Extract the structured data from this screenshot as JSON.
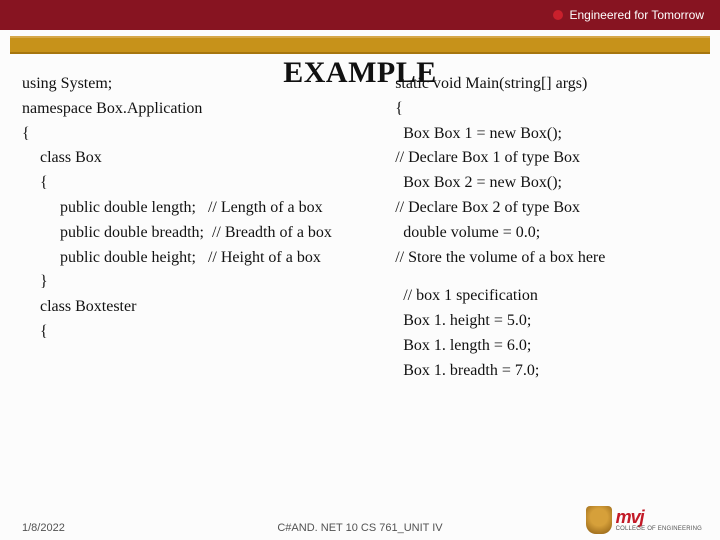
{
  "header": {
    "tagline": "Engineered for Tomorrow"
  },
  "title": "EXAMPLE",
  "left": {
    "l0": "using System;",
    "l1": "namespace Box.Application",
    "l2": "{",
    "l3": "class Box",
    "l4": "{",
    "l5": " public double length;   // Length of a box",
    "l6": " public double breadth;  // Breadth of a box",
    "l7": " public double height;   // Height of a box",
    "l8": "}",
    "l9": "class Boxtester",
    "l10": "{"
  },
  "right": {
    "r0": "static void Main(string[] args)",
    "r1": "{",
    "r2": "  Box Box 1 = new Box();",
    "r3": "// Declare Box 1 of type Box",
    "r4": "  Box Box 2 = new Box();",
    "r5": "// Declare Box 2 of type Box",
    "r6": "  double volume = 0.0;",
    "r7": "// Store the volume of a box here",
    "r8": "  // box 1 specification",
    "r9": "  Box 1. height = 5.0;",
    "r10": "  Box 1. length = 6.0;",
    "r11": "  Box 1. breadth = 7.0;"
  },
  "footer": {
    "date": "1/8/2022",
    "center": "C#AND. NET 10 CS 761_UNIT IV",
    "logo_main": "mvj",
    "logo_sub": "COLLEGE OF ENGINEERING"
  }
}
